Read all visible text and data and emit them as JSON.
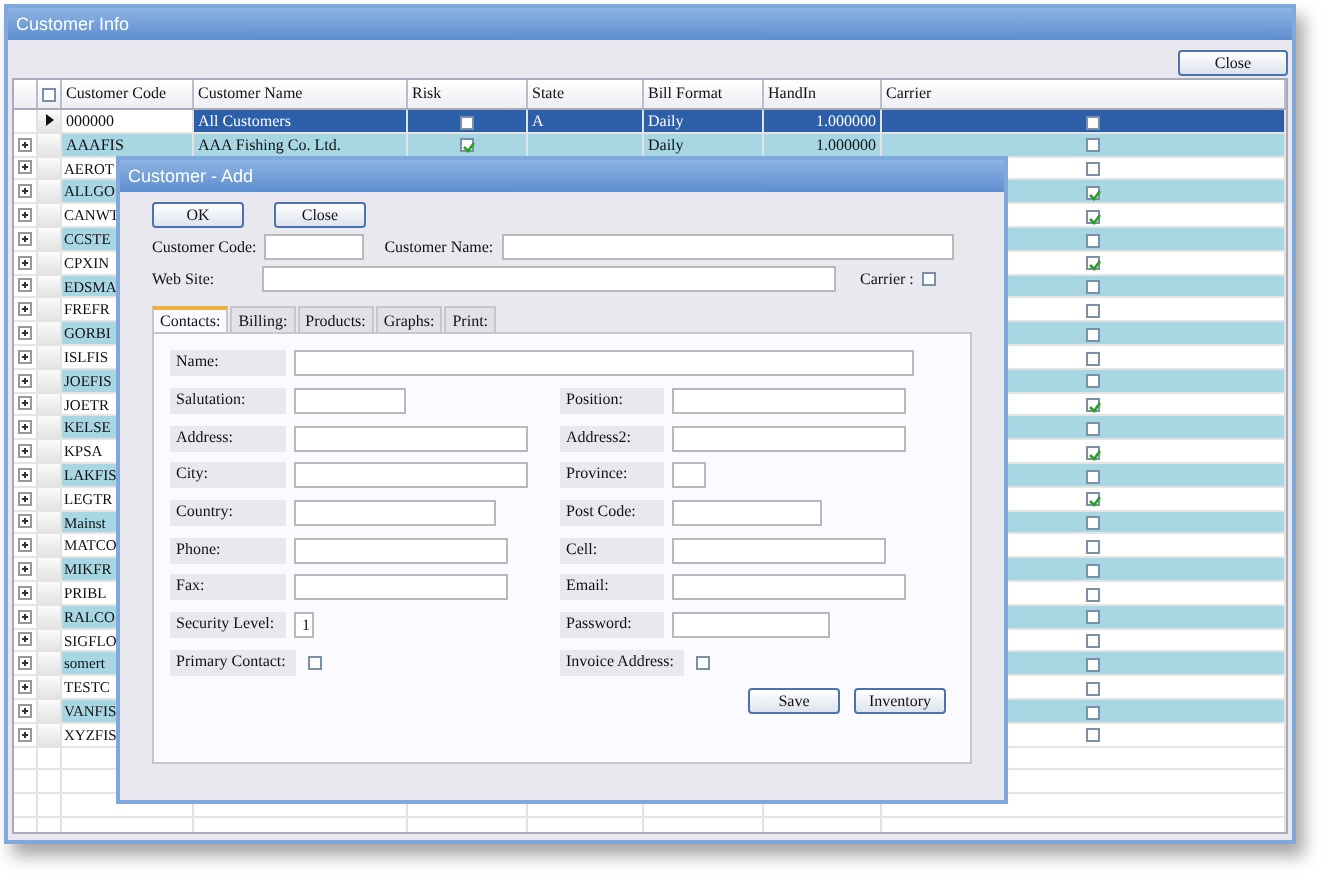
{
  "window": {
    "title": "Customer Info",
    "close_button": "Close"
  },
  "grid": {
    "columns": [
      "Customer Code",
      "Customer Name",
      "Risk",
      "State",
      "Bill Format",
      "HandIn",
      "Carrier"
    ],
    "rows": [
      {
        "code": "000000",
        "name": "All Customers",
        "risk": false,
        "state": "A",
        "bill_format": "Daily",
        "handin": "1.000000",
        "carrier": false,
        "selected": true,
        "expandable": false
      },
      {
        "code": "AAAFIS",
        "name": "AAA Fishing Co. Ltd.",
        "risk": true,
        "bill_format": "Daily",
        "handin": "1.000000",
        "carrier": false,
        "selected": false,
        "expandable": true
      },
      {
        "code": "AEROT",
        "carrier": false,
        "selected": false,
        "expandable": true
      },
      {
        "code": "ALLGO",
        "carrier": true,
        "selected": false,
        "expandable": true
      },
      {
        "code": "CANWT",
        "carrier": true,
        "selected": false,
        "expandable": true
      },
      {
        "code": "CCSTE",
        "carrier": false,
        "selected": false,
        "expandable": true
      },
      {
        "code": "CPXIN",
        "carrier": true,
        "selected": false,
        "expandable": true
      },
      {
        "code": "EDSMA",
        "carrier": false,
        "selected": false,
        "expandable": true
      },
      {
        "code": "FREFR",
        "carrier": false,
        "selected": false,
        "expandable": true
      },
      {
        "code": "GORBI",
        "carrier": false,
        "selected": false,
        "expandable": true
      },
      {
        "code": "ISLFIS",
        "carrier": false,
        "selected": false,
        "expandable": true
      },
      {
        "code": "JOEFIS",
        "carrier": false,
        "selected": false,
        "expandable": true
      },
      {
        "code": "JOETR",
        "carrier": true,
        "selected": false,
        "expandable": true
      },
      {
        "code": "KELSE",
        "carrier": false,
        "selected": false,
        "expandable": true
      },
      {
        "code": "KPSA",
        "carrier": true,
        "selected": false,
        "expandable": true
      },
      {
        "code": "LAKFIS",
        "carrier": false,
        "selected": false,
        "expandable": true
      },
      {
        "code": "LEGTR",
        "carrier": true,
        "selected": false,
        "expandable": true
      },
      {
        "code": "Mainst",
        "carrier": false,
        "selected": false,
        "expandable": true
      },
      {
        "code": "MATCO",
        "carrier": false,
        "selected": false,
        "expandable": true
      },
      {
        "code": "MIKFR",
        "carrier": false,
        "selected": false,
        "expandable": true
      },
      {
        "code": "PRIBL",
        "carrier": false,
        "selected": false,
        "expandable": true
      },
      {
        "code": "RALCO",
        "carrier": false,
        "selected": false,
        "expandable": true
      },
      {
        "code": "SIGFLO",
        "carrier": false,
        "selected": false,
        "expandable": true
      },
      {
        "code": "somert",
        "carrier": false,
        "selected": false,
        "expandable": true
      },
      {
        "code": "TESTC",
        "carrier": false,
        "selected": false,
        "expandable": true
      },
      {
        "code": "VANFIS",
        "carrier": false,
        "selected": false,
        "expandable": true
      },
      {
        "code": "XYZFIS",
        "carrier": false,
        "selected": false,
        "expandable": true
      }
    ]
  },
  "dialog": {
    "title": "Customer - Add",
    "buttons": [
      "OK",
      "Close"
    ],
    "customer_code": {
      "label": "Customer Code:"
    },
    "customer_name": {
      "label": "Customer Name:"
    },
    "web_site": {
      "label": "Web Site:"
    },
    "carrier": {
      "label": "Carrier :",
      "checked": false
    },
    "tabs": [
      {
        "label": "Contacts:",
        "selected": true
      },
      {
        "label": "Billing:",
        "selected": false
      },
      {
        "label": "Products:",
        "selected": false
      },
      {
        "label": "Graphs:",
        "selected": false
      },
      {
        "label": "Print:",
        "selected": false
      }
    ],
    "contact_rows": [
      {
        "left": {
          "label": "Name:",
          "kind": "wide"
        }
      },
      {
        "left": {
          "label": "Salutation:",
          "kind": "text"
        },
        "right": {
          "label": "Position:",
          "kind": "text"
        }
      },
      {
        "left": {
          "label": "Address:",
          "kind": "text"
        },
        "right": {
          "label": "Address2:",
          "kind": "text"
        }
      },
      {
        "left": {
          "label": "City:",
          "kind": "text"
        },
        "right": {
          "label": "Province:",
          "kind": "text"
        }
      },
      {
        "left": {
          "label": "Country:",
          "kind": "text"
        },
        "right": {
          "label": "Post Code:",
          "kind": "text"
        }
      },
      {
        "left": {
          "label": "Phone:",
          "kind": "text"
        },
        "right": {
          "label": "Cell:",
          "kind": "text"
        }
      },
      {
        "left": {
          "label": "Fax:",
          "kind": "text"
        },
        "right": {
          "label": "Email:",
          "kind": "text"
        }
      },
      {
        "left": {
          "label": "Security Level:",
          "kind": "text",
          "value": "1"
        },
        "right": {
          "label": "Password:",
          "kind": "text"
        }
      },
      {
        "left": {
          "label": "Primary Contact:",
          "kind": "check",
          "checked": false
        },
        "right": {
          "label": "Invoice Address:",
          "kind": "check",
          "checked": false
        }
      }
    ],
    "action_buttons": [
      "Save",
      "Inventory"
    ]
  }
}
